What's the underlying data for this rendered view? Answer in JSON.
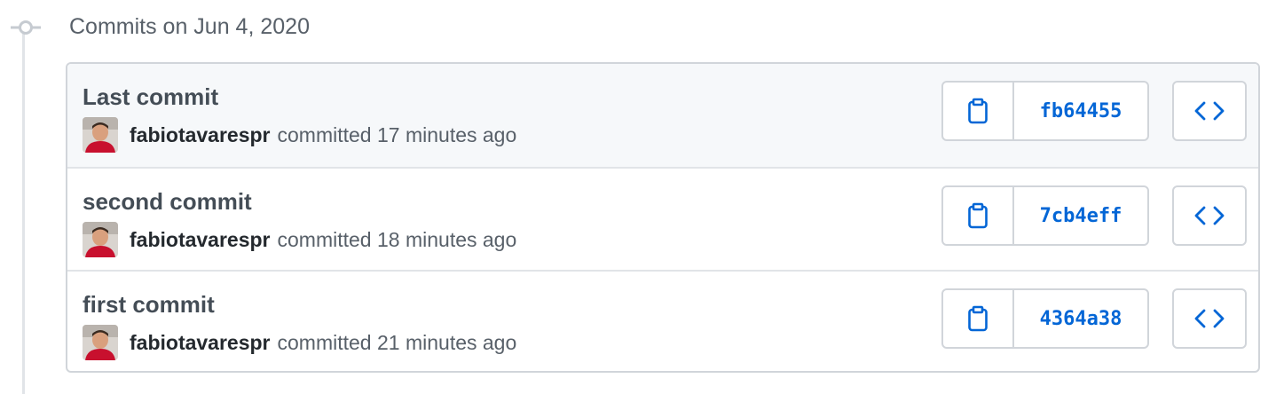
{
  "group": {
    "date_label": "Commits on Jun 4, 2020"
  },
  "colors": {
    "link": "#0366d6",
    "border": "#d1d5da",
    "timeline": "#e1e4e8",
    "highlight_row": "#f6f8fa",
    "avatar_shirt": "#c8102e"
  },
  "icons": {
    "timeline": "git-commit-icon",
    "copy": "clipboard-icon",
    "browse": "code-icon"
  },
  "commits": [
    {
      "title": "Last commit",
      "author": "fabiotavarespr",
      "meta": "committed 17 minutes ago",
      "sha": "fb64455"
    },
    {
      "title": "second commit",
      "author": "fabiotavarespr",
      "meta": "committed 18 minutes ago",
      "sha": "7cb4eff"
    },
    {
      "title": "first commit",
      "author": "fabiotavarespr",
      "meta": "committed 21 minutes ago",
      "sha": "4364a38"
    }
  ]
}
